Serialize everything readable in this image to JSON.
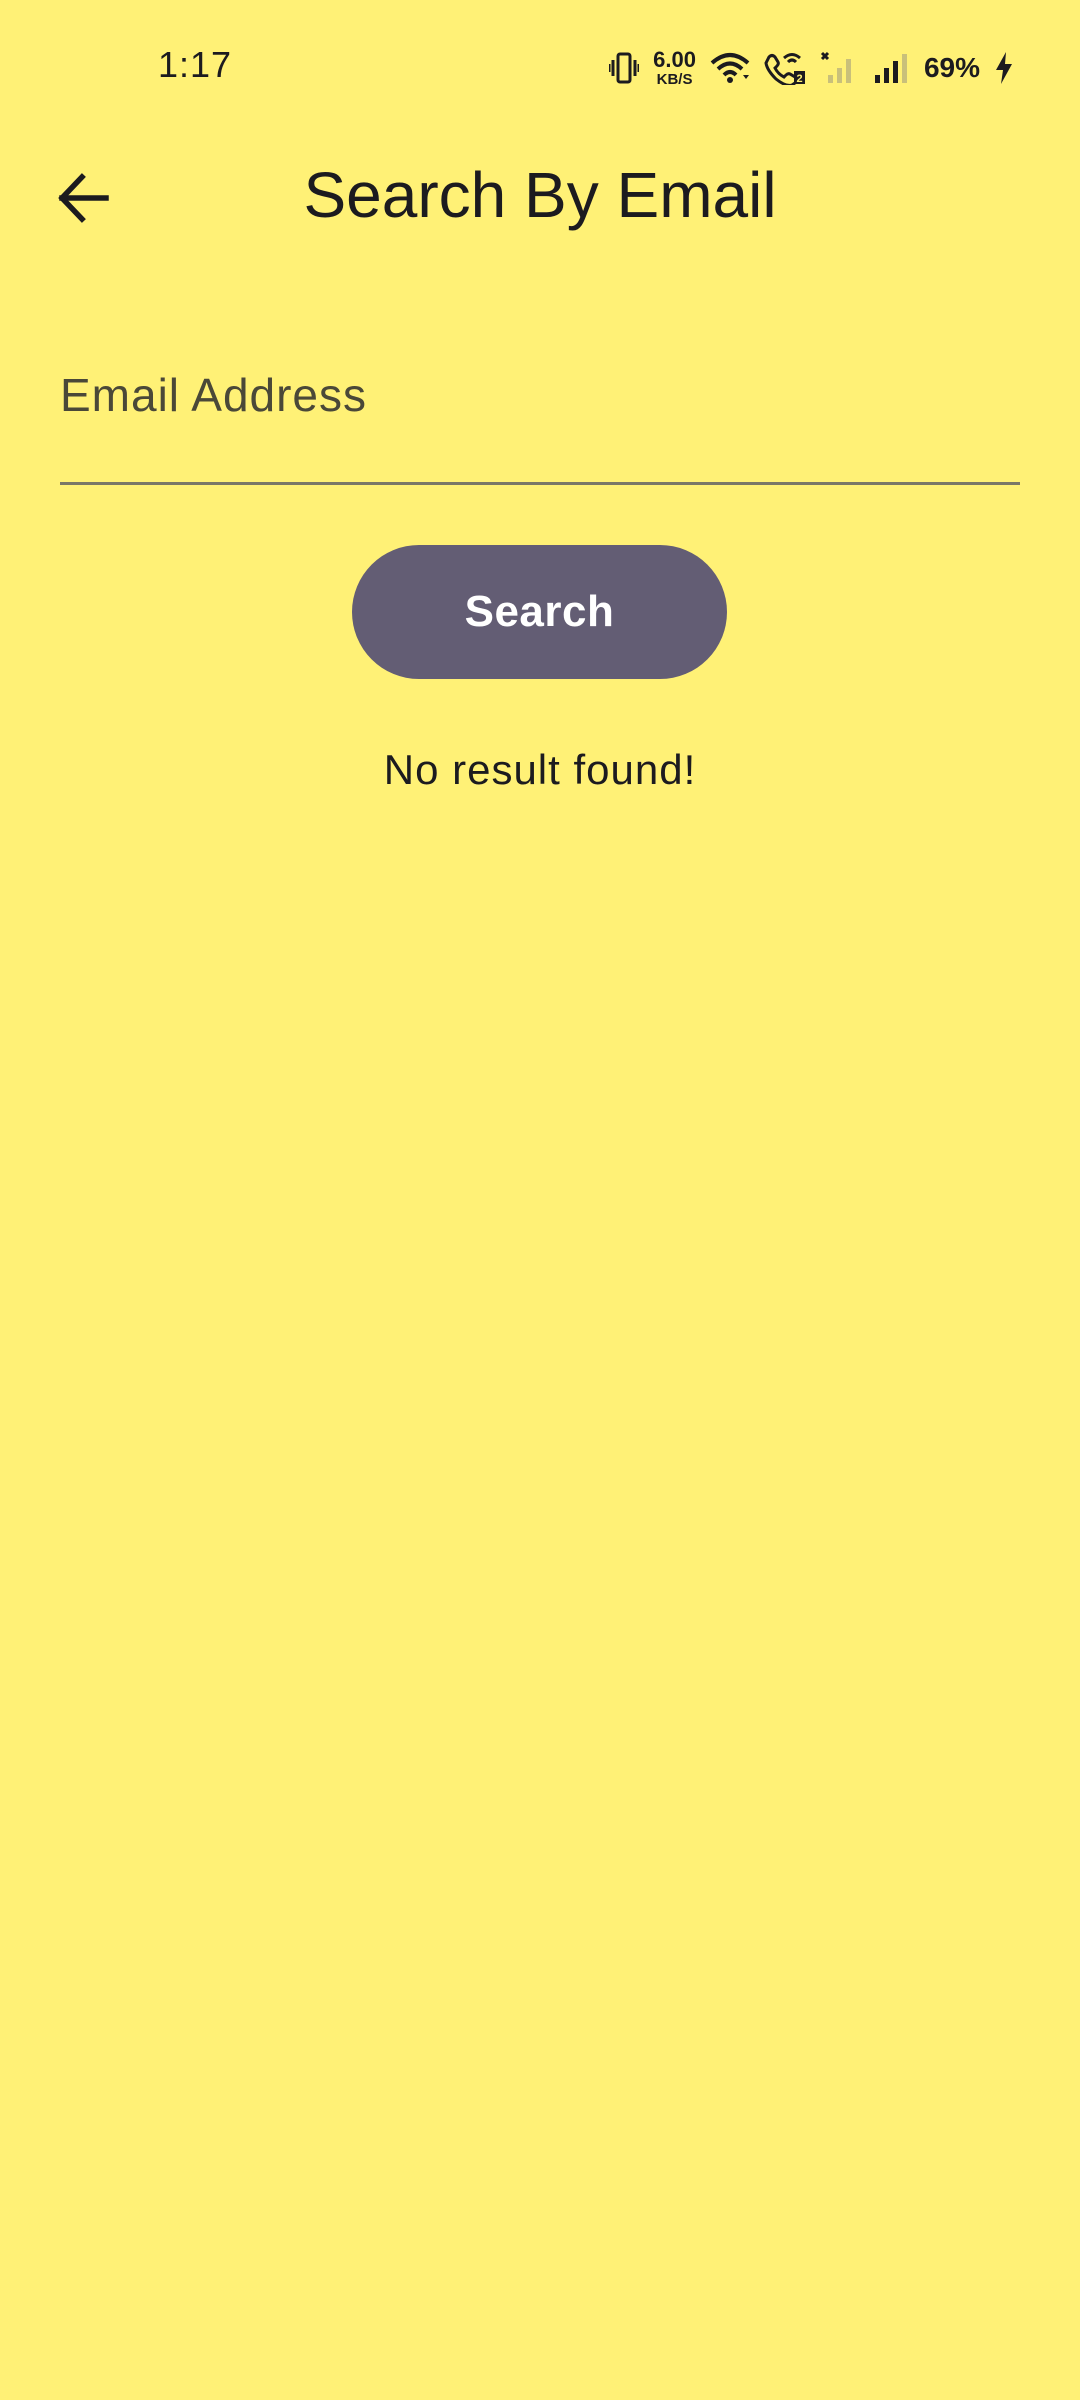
{
  "status_bar": {
    "time": "1:17",
    "net_speed_value": "6.00",
    "net_speed_unit": "KB/S",
    "battery_percent": "69%",
    "icons": [
      "vibrate-icon",
      "wifi-icon",
      "wifi-calling-icon",
      "signal-disabled-icon",
      "signal-icon",
      "battery-charging-icon"
    ]
  },
  "app_bar": {
    "back_icon": "arrow-back-icon",
    "title": "Search By Email"
  },
  "form": {
    "email_placeholder": "Email Address",
    "email_value": "",
    "search_label": "Search"
  },
  "result": {
    "message": "No result found!"
  },
  "colors": {
    "background": "#FFF176",
    "button": "#635D74",
    "button_text": "#FFFFFF",
    "text": "#1C1B1F"
  }
}
